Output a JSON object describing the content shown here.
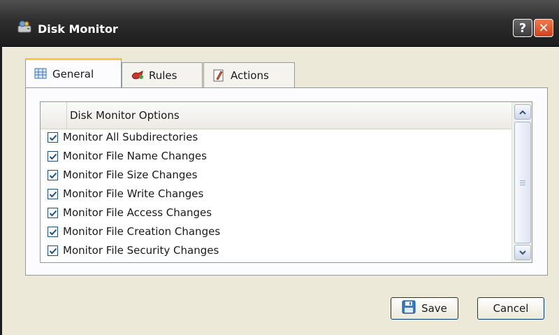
{
  "window": {
    "title": "Disk Monitor",
    "help_label": "?",
    "close_label": "✕"
  },
  "tabs": [
    {
      "label": "General",
      "icon": "grid-icon",
      "active": true
    },
    {
      "label": "Rules",
      "icon": "rules-icon",
      "active": false
    },
    {
      "label": "Actions",
      "icon": "actions-icon",
      "active": false
    }
  ],
  "options": {
    "header": "Disk Monitor Options",
    "items": [
      {
        "label": "Monitor All Subdirectories",
        "checked": true
      },
      {
        "label": "Monitor File Name Changes",
        "checked": true
      },
      {
        "label": "Monitor File Size Changes",
        "checked": true
      },
      {
        "label": "Monitor File Write Changes",
        "checked": true
      },
      {
        "label": "Monitor File Access Changes",
        "checked": true
      },
      {
        "label": "Monitor File Creation Changes",
        "checked": true
      },
      {
        "label": "Monitor File Security Changes",
        "checked": true
      }
    ]
  },
  "buttons": {
    "save_label": "Save",
    "cancel_label": "Cancel"
  },
  "colors": {
    "titlebar": "#2e2e2e",
    "dialog_bg": "#ece9d8",
    "active_tab_accent": "#ffc83c",
    "close_button": "#d2401a",
    "checkmark": "#1c5180"
  }
}
